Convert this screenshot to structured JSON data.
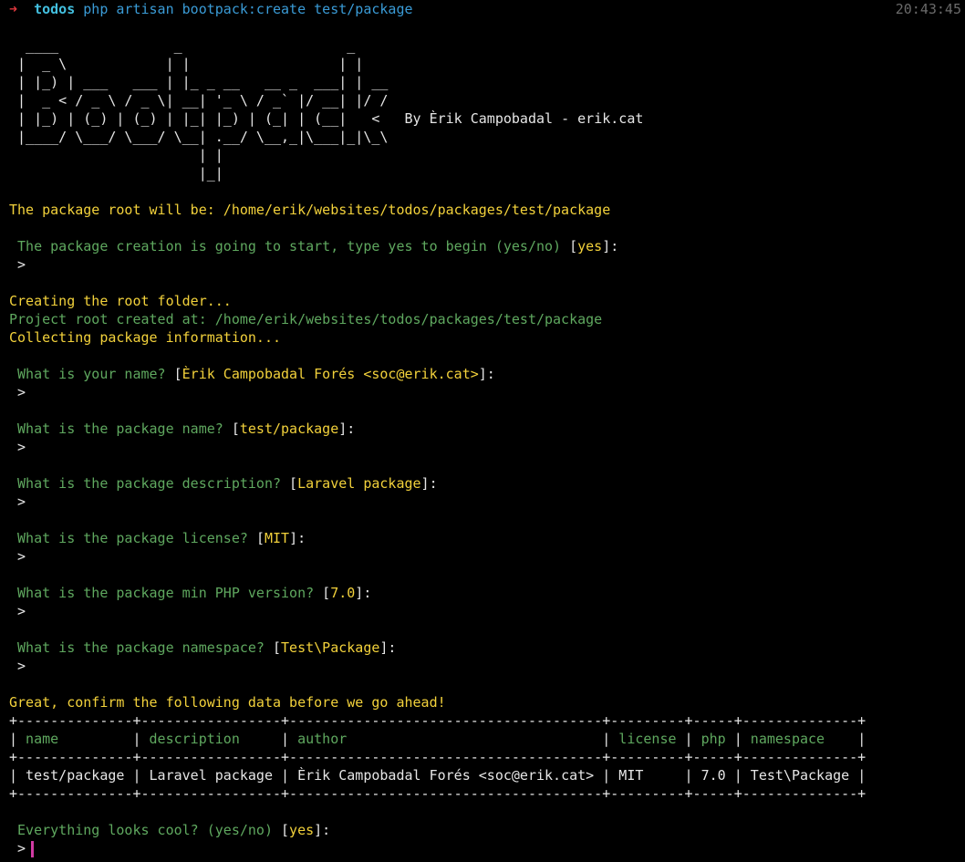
{
  "prompt": {
    "arrow": "➜",
    "dir": "todos",
    "command": "php artisan bootpack:create test/package",
    "time": "20:43:45"
  },
  "banner": {
    "lines": [
      "  ____              _                    _",
      " |  _ \\            | |                  | |",
      " | |_) | ___   ___ | |_ _ __   __ _  ___| | __",
      " |  _ < / _ \\ / _ \\| __| '_ \\ / _` |/ __| |/ /",
      " | |_) | (_) | (_) | |_| |_) | (_| | (__|   <",
      " |____/ \\___/ \\___/ \\__| .__/ \\__,_|\\___|_|\\_\\",
      "                       | |",
      "                       |_|"
    ],
    "author_credit": "By Èrik Campobadal - erik.cat"
  },
  "root_notice": "The package root will be: /home/erik/websites/todos/packages/test/package",
  "start_question": {
    "text": " The package creation is going to start, type yes to begin (yes/no) ",
    "default": "yes"
  },
  "prompt_char": " >",
  "status": {
    "creating": "Creating the root folder...",
    "created": "Project root created at: /home/erik/websites/todos/packages/test/package",
    "collecting": "Collecting package information..."
  },
  "questions": [
    {
      "text": " What is your name? ",
      "default": "Èrik Campobadal Forés <soc@erik.cat>"
    },
    {
      "text": " What is the package name? ",
      "default": "test/package"
    },
    {
      "text": " What is the package description? ",
      "default": "Laravel package"
    },
    {
      "text": " What is the package license? ",
      "default": "MIT"
    },
    {
      "text": " What is the package min PHP version? ",
      "default": "7.0"
    },
    {
      "text": " What is the package namespace? ",
      "default": "Test\\Package"
    }
  ],
  "confirm_heading": "Great, confirm the following data before we go ahead!",
  "table": {
    "border": "+--------------+-----------------+--------------------------------------+---------+-----+--------------+",
    "headers": [
      " name         ",
      " description     ",
      " author                               ",
      " license ",
      " php ",
      " namespace    "
    ],
    "row": [
      " test/package ",
      " Laravel package ",
      " Èrik Campobadal Forés <soc@erik.cat> ",
      " MIT     ",
      " 7.0 ",
      " Test\\Package "
    ]
  },
  "final_question": {
    "text": " Everything looks cool? (yes/no) ",
    "default": "yes"
  },
  "colors": {
    "yellow": "#f2d13b",
    "green": "#5fa85f",
    "cursor": "#d13aa3"
  }
}
